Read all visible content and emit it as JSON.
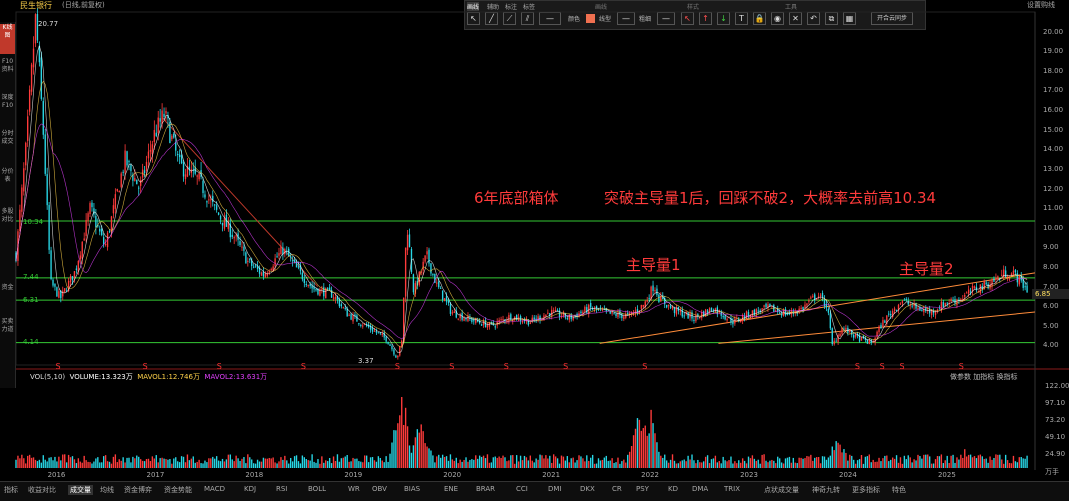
{
  "header": {
    "stock_name": "民生银行",
    "stock_sub": "(日线,前复权)",
    "settings": "设置购线"
  },
  "toolbar": {
    "tabs": [
      "画线",
      "辅助",
      "标注",
      "标签"
    ],
    "section_labels": [
      "画线",
      "样式",
      "工具"
    ],
    "color_label": "颜色",
    "line_label": "线型",
    "width_label": "粗细",
    "sync_label": "开合云同步"
  },
  "sidebar": {
    "items": [
      "K线图",
      "F10资料",
      "深度F10",
      "分时成交",
      "分价表",
      "多股对比",
      "资金",
      "买卖力道"
    ]
  },
  "annotations": {
    "box": "6年底部箱体",
    "breakout": "突破主导量1后，回踩不破2，大概率去前高10.34",
    "vol1": "主导量1",
    "vol2": "主导量2"
  },
  "price_labels": {
    "high": "20.77",
    "low": "3.37",
    "l1034": "10.34",
    "l744": "7.44",
    "l631": "6.31",
    "l414": "4.14",
    "last": "6.85"
  },
  "y_ticks": [
    "20.00",
    "19.00",
    "18.00",
    "17.00",
    "16.00",
    "15.00",
    "14.00",
    "13.00",
    "12.00",
    "11.00",
    "10.00",
    "9.00",
    "8.00",
    "7.00",
    "6.00",
    "5.00",
    "4.00"
  ],
  "x_ticks": [
    "2016",
    "2017",
    "2018",
    "2019",
    "2020",
    "2021",
    "2022",
    "2023",
    "2024",
    "2025"
  ],
  "volume": {
    "legend_vol": "VOL(5,10)",
    "legend_volume": "VOLUME:13.323万",
    "legend_ma1": "MAVOL1:12.746万",
    "legend_ma2": "MAVOL2:13.631万",
    "buttons": "做参数  加指标  换指标",
    "y_ticks": [
      "122.00",
      "97.10",
      "73.20",
      "49.10",
      "24.90",
      "万手"
    ]
  },
  "bottom": {
    "tabs": [
      "指标",
      "收益对比",
      "成交量",
      "均线",
      "资金博弈",
      "资金势能",
      "MACD",
      "KDJ",
      "RSI",
      "BOLL",
      "WR",
      "OBV",
      "BIAS",
      "ENE",
      "BRAR",
      "CCI",
      "DMI",
      "DKX",
      "CR",
      "PSY",
      "KD",
      "DMA",
      "TRIX",
      "点状成交量",
      "神奇九转",
      "更多指标",
      "特色"
    ]
  },
  "colors": {
    "up": "#ff3b3b",
    "down": "#28d7e6",
    "green_line": "#34c934",
    "trend_line": "#c0392b",
    "channel": "#ff8c3a",
    "ma1": "#ffffff",
    "ma2": "#ffd24a",
    "ma3": "#e040fb"
  },
  "chart_data": {
    "type": "candlestick",
    "y_range": [
      3.0,
      21.0
    ],
    "x_range": [
      2015.6,
      2025.9
    ],
    "price_path": [
      [
        2015.6,
        8.6
      ],
      [
        2015.7,
        14
      ],
      [
        2015.8,
        20.77
      ],
      [
        2015.88,
        14.5
      ],
      [
        2015.95,
        7.2
      ],
      [
        2016.05,
        6.4
      ],
      [
        2016.2,
        7.8
      ],
      [
        2016.35,
        11
      ],
      [
        2016.5,
        9
      ],
      [
        2016.7,
        13.5
      ],
      [
        2016.85,
        12
      ],
      [
        2017.0,
        14.8
      ],
      [
        2017.1,
        15.8
      ],
      [
        2017.25,
        13.2
      ],
      [
        2017.45,
        12.4
      ],
      [
        2017.6,
        11
      ],
      [
        2017.8,
        9.6
      ],
      [
        2017.95,
        8.2
      ],
      [
        2018.1,
        7.6
      ],
      [
        2018.3,
        8.9
      ],
      [
        2018.45,
        7.8
      ],
      [
        2018.6,
        6.9
      ],
      [
        2018.8,
        6.6
      ],
      [
        2018.95,
        5.6
      ],
      [
        2019.2,
        4.8
      ],
      [
        2019.35,
        4.3
      ],
      [
        2019.45,
        3.37
      ],
      [
        2019.5,
        4.2
      ],
      [
        2019.55,
        10.34
      ],
      [
        2019.62,
        6.7
      ],
      [
        2019.75,
        8.6
      ],
      [
        2019.85,
        7.1
      ],
      [
        2020.0,
        5.7
      ],
      [
        2020.2,
        5.3
      ],
      [
        2020.4,
        5.0
      ],
      [
        2020.6,
        5.5
      ],
      [
        2020.8,
        5.2
      ],
      [
        2021.0,
        5.7
      ],
      [
        2021.2,
        5.4
      ],
      [
        2021.4,
        5.9
      ],
      [
        2021.6,
        5.6
      ],
      [
        2021.8,
        5.5
      ],
      [
        2021.95,
        6.1
      ],
      [
        2022.05,
        7.1
      ],
      [
        2022.1,
        6.4
      ],
      [
        2022.25,
        5.8
      ],
      [
        2022.45,
        5.4
      ],
      [
        2022.65,
        5.9
      ],
      [
        2022.85,
        5.2
      ],
      [
        2023.0,
        5.6
      ],
      [
        2023.2,
        5.9
      ],
      [
        2023.4,
        5.6
      ],
      [
        2023.55,
        5.9
      ],
      [
        2023.7,
        6.6
      ],
      [
        2023.8,
        6.0
      ],
      [
        2023.85,
        4.0
      ],
      [
        2023.95,
        4.9
      ],
      [
        2024.1,
        4.4
      ],
      [
        2024.25,
        4.1
      ],
      [
        2024.35,
        5.1
      ],
      [
        2024.55,
        6.3
      ],
      [
        2024.7,
        5.9
      ],
      [
        2024.85,
        5.7
      ],
      [
        2025.0,
        6.2
      ],
      [
        2025.15,
        6.4
      ],
      [
        2025.3,
        6.9
      ],
      [
        2025.45,
        7.2
      ],
      [
        2025.6,
        7.7
      ],
      [
        2025.7,
        7.6
      ],
      [
        2025.82,
        6.85
      ]
    ],
    "horizontal_levels": [
      10.34,
      7.44,
      6.31,
      4.14
    ],
    "trend_line": [
      [
        2017.08,
        15.6
      ],
      [
        2018.65,
        7.0
      ]
    ],
    "channel_lines": [
      [
        [
          2021.5,
          4.1
        ],
        [
          2025.9,
          7.7
        ]
      ],
      [
        [
          2022.7,
          4.1
        ],
        [
          2025.9,
          5.7
        ]
      ]
    ],
    "volume_spikes": [
      [
        2016.0,
        14
      ],
      [
        2016.9,
        20
      ],
      [
        2019.5,
        122
      ],
      [
        2019.7,
        82
      ],
      [
        2021.9,
        87
      ],
      [
        2022.0,
        100
      ],
      [
        2023.9,
        55
      ],
      [
        2025.2,
        35
      ]
    ],
    "volume_range": [
      0,
      125
    ],
    "s_marks": [
      2016.02,
      2016.9,
      2017.65,
      2018.5,
      2019.45,
      2020.0,
      2020.55,
      2021.15,
      2021.95,
      2024.1,
      2024.35,
      2024.55,
      2025.15
    ]
  }
}
